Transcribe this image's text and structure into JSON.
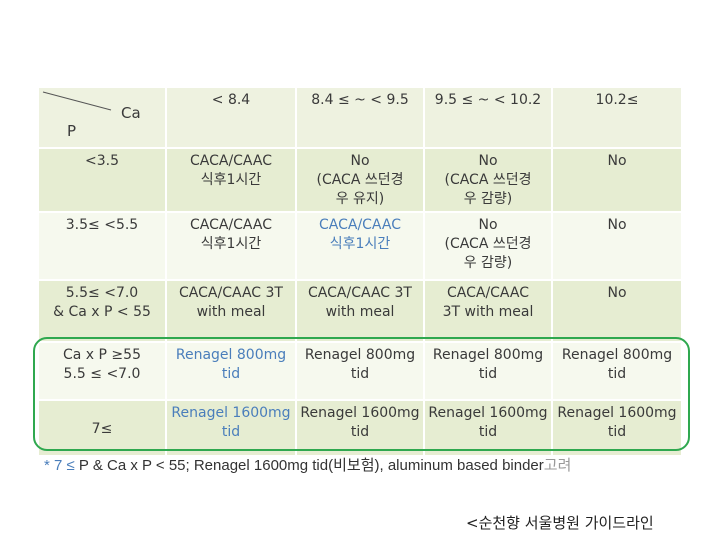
{
  "header": {
    "corner_top": "Ca",
    "corner_bottom": "P",
    "columns": [
      "< 8.4",
      "8.4 ≤ ~ < 9.5",
      "9.5 ≤ ~ < 10.2",
      "10.2≤"
    ]
  },
  "rows": [
    {
      "label": [
        "<3.5"
      ],
      "cells": [
        [
          "CACA/CAAC",
          "식후1시간"
        ],
        [
          "No",
          "(CACA 쓰던경",
          "우 유지)"
        ],
        [
          "No",
          "(CACA 쓰던경",
          "우 감량)"
        ],
        [
          "No"
        ]
      ]
    },
    {
      "label": [
        "3.5≤ <5.5"
      ],
      "cells": [
        [
          "CACA/CAAC",
          "식후1시간"
        ],
        [
          "CACA/CAAC",
          "식후1시간"
        ],
        [
          "No",
          "(CACA 쓰던경",
          "우 감량)"
        ],
        [
          "No"
        ]
      ]
    },
    {
      "label": [
        "5.5≤ <7.0",
        "& Ca x P < 55"
      ],
      "cells": [
        [
          "CACA/CAAC 3T",
          "with meal"
        ],
        [
          "CACA/CAAC 3T",
          "with meal"
        ],
        [
          "CACA/CAAC",
          "3T with meal"
        ],
        [
          "No"
        ]
      ]
    },
    {
      "label": [
        "Ca x P ≥55",
        "5.5 ≤ <7.0"
      ],
      "cells": [
        [
          "Renagel 800mg",
          "tid"
        ],
        [
          "Renagel 800mg",
          "tid"
        ],
        [
          "Renagel 800mg",
          "tid"
        ],
        [
          "Renagel 800mg",
          "tid"
        ]
      ]
    },
    {
      "label": [
        "7≤"
      ],
      "cells": [
        [
          "Renagel 1600mg",
          "tid"
        ],
        [
          "Renagel 1600mg",
          "tid"
        ],
        [
          "Renagel 1600mg",
          "tid"
        ],
        [
          "Renagel 1600mg",
          "tid"
        ]
      ]
    }
  ],
  "footnote": {
    "star": "* 7 ≤",
    "main": " P & Ca x P < 55; Renagel 1600mg tid(비보험), aluminum based binder",
    "faded": "고려"
  },
  "source": "<순천향 서울병원 가이드라인",
  "colors": {
    "header_bg": "#eef2e0",
    "light_row_bg": "#f6f9ee",
    "dark_row_bg": "#e6edd2",
    "highlight_text": "#4a7ebb",
    "box_border": "#2fa84f"
  }
}
